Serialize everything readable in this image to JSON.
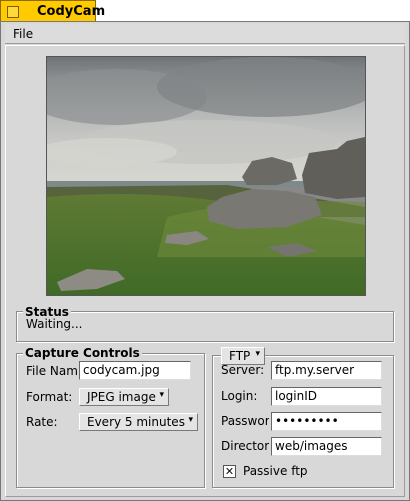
{
  "window": {
    "title": "CodyCam"
  },
  "menu": {
    "file": "File"
  },
  "status": {
    "title": "Status",
    "text": "Waiting..."
  },
  "capture": {
    "title": "Capture Controls",
    "file_name_label": "File Name:",
    "file_name_value": "codycam.jpg",
    "format_label": "Format:",
    "format_value": "JPEG image",
    "rate_label": "Rate:",
    "rate_value": "Every 5 minutes"
  },
  "ftp": {
    "menu_label": "FTP",
    "server_label": "Server:",
    "server_value": "ftp.my.server",
    "login_label": "Login:",
    "login_value": "loginID",
    "password_label": "Password:",
    "password_value": "•••••••••",
    "directory_label": "Directory:",
    "directory_value": "web/images",
    "passive_label": "Passive ftp",
    "passive_checked": "✕"
  },
  "colors": {
    "tab": "#ffcb00",
    "window": "#d8d8d8"
  }
}
